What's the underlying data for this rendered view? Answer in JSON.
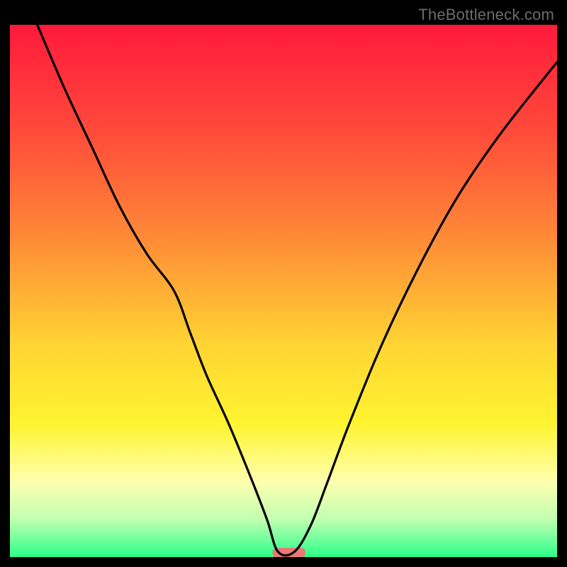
{
  "watermark": "TheBottleneck.com",
  "chart_data": {
    "type": "line",
    "title": "",
    "xlabel": "",
    "ylabel": "",
    "xlim": [
      0,
      100
    ],
    "ylim": [
      0,
      100
    ],
    "grid": false,
    "legend": false,
    "background_gradient": {
      "stops": [
        {
          "offset": 0.0,
          "color": "#ff1a3c"
        },
        {
          "offset": 0.2,
          "color": "#ff4a3a"
        },
        {
          "offset": 0.4,
          "color": "#ff8a37"
        },
        {
          "offset": 0.6,
          "color": "#ffd433"
        },
        {
          "offset": 0.75,
          "color": "#fff430"
        },
        {
          "offset": 0.86,
          "color": "#fdffb0"
        },
        {
          "offset": 0.93,
          "color": "#c0ffb0"
        },
        {
          "offset": 1.0,
          "color": "#2bff8a"
        }
      ]
    },
    "marker": {
      "x": 51,
      "y": 0,
      "width_pct": 6,
      "color": "#e77a72"
    },
    "series": [
      {
        "name": "bottleneck-curve",
        "x": [
          5,
          10,
          15,
          20,
          25,
          30,
          33,
          36,
          40,
          44,
          47,
          49,
          52,
          55,
          58,
          62,
          68,
          75,
          82,
          90,
          100
        ],
        "y": [
          100,
          88,
          77,
          66,
          57,
          50,
          42,
          34,
          25,
          15,
          7,
          1,
          1,
          6,
          14,
          25,
          40,
          55,
          68,
          80,
          93
        ]
      }
    ]
  }
}
